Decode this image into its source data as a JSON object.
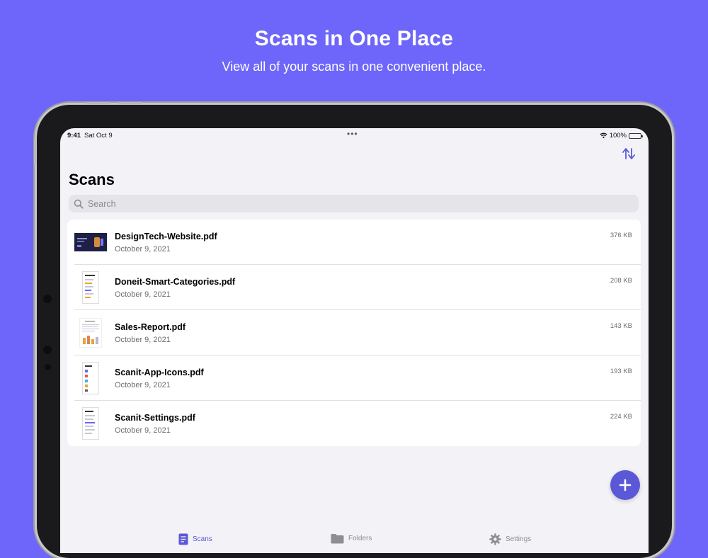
{
  "promo": {
    "headline": "Scans in One Place",
    "subline": "View all of your scans in one convenient place."
  },
  "status_bar": {
    "time": "9:41",
    "date": "Sat Oct 9",
    "battery": "100%"
  },
  "nav": {
    "title": "Scans",
    "sort_icon": "sort-arrows-icon"
  },
  "search": {
    "placeholder": "Search",
    "value": ""
  },
  "files": [
    {
      "name": "DesignTech-Website.pdf",
      "date": "October 9, 2021",
      "size": "376 KB"
    },
    {
      "name": "Doneit-Smart-Categories.pdf",
      "date": "October 9, 2021",
      "size": "208 KB"
    },
    {
      "name": "Sales-Report.pdf",
      "date": "October 9, 2021",
      "size": "143 KB"
    },
    {
      "name": "Scanit-App-Icons.pdf",
      "date": "October 9, 2021",
      "size": "193 KB"
    },
    {
      "name": "Scanit-Settings.pdf",
      "date": "October 9, 2021",
      "size": "224 KB"
    }
  ],
  "fab": {
    "icon": "plus-icon"
  },
  "tabs": [
    {
      "label": "Scans",
      "icon": "document-icon",
      "active": true
    },
    {
      "label": "Folders",
      "icon": "folder-icon",
      "active": false
    },
    {
      "label": "Settings",
      "icon": "gear-icon",
      "active": false
    }
  ],
  "colors": {
    "background": "#6e66fa",
    "accent": "#5b58d8",
    "screen": "#f2f2f7"
  }
}
